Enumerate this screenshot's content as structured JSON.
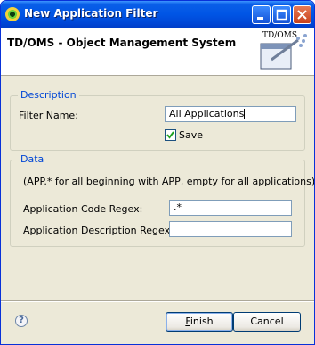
{
  "window": {
    "title": "New Application Filter"
  },
  "header": {
    "title": "TD/OMS - Object Management System",
    "banner_text": "TD/OMS"
  },
  "description_group": {
    "legend": "Description",
    "filter_name_label": "Filter Name:",
    "filter_name_value": "All Applications",
    "save_label": "Save",
    "save_checked": true
  },
  "data_group": {
    "legend": "Data",
    "hint": "(APP.* for all beginning with APP, empty for all applications)",
    "code_regex_label": "Application Code Regex:",
    "code_regex_value": ".*",
    "desc_regex_label": "Application Description Regex:",
    "desc_regex_value": ""
  },
  "footer": {
    "help_icon": "?",
    "finish_mnemonic": "F",
    "finish_rest": "inish",
    "cancel_label": "Cancel"
  },
  "colors": {
    "titlebar": "#0055e5",
    "legend_text": "#0046d5",
    "dialog_bg": "#ece9d8"
  }
}
